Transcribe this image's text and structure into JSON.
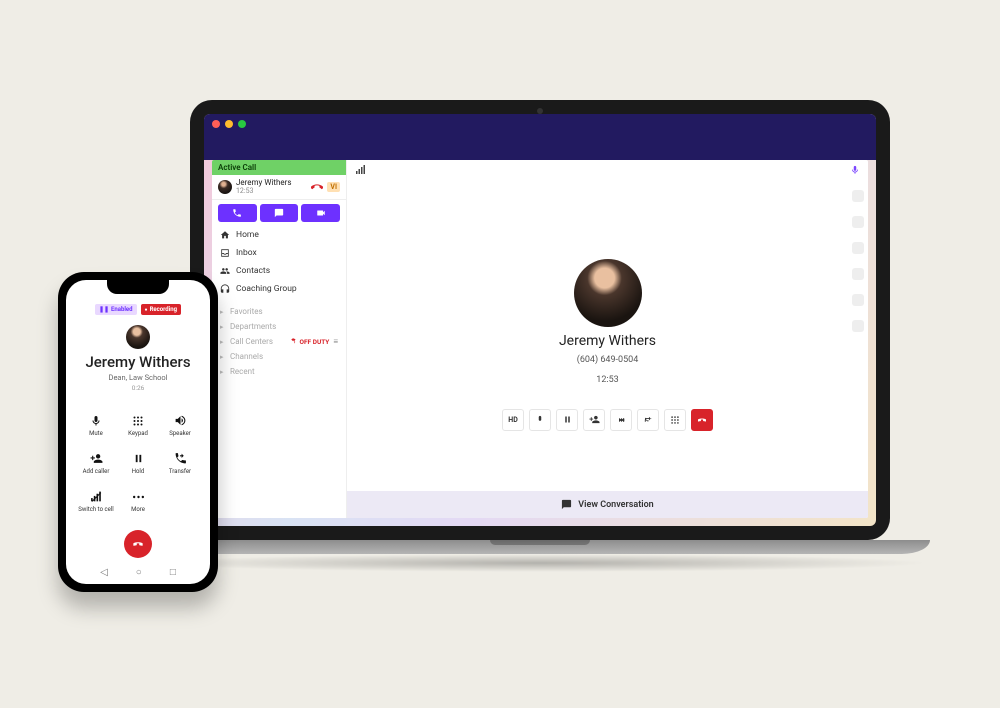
{
  "colors": {
    "accent": "#6d31ff",
    "danger": "#d8232a",
    "active_green": "#6fd166",
    "header_purple": "#221a60"
  },
  "laptop": {
    "active_call_label": "Active Call",
    "active_call_name": "Jeremy Withers",
    "active_call_time": "12:53",
    "active_call_badge": "VI",
    "triple_buttons": {
      "phone": "phone-icon",
      "chat": "chat-icon",
      "video": "video-icon"
    },
    "nav": {
      "home": "Home",
      "inbox": "Inbox",
      "contacts": "Contacts",
      "coaching": "Coaching Group"
    },
    "groups": {
      "favorites": "Favorites",
      "departments": "Departments",
      "call_centers": "Call Centers",
      "channels": "Channels",
      "recent": "Recent",
      "off_duty": "OFF DUTY"
    },
    "main": {
      "name": "Jeremy Withers",
      "phone_number": "(604) 649-0504",
      "duration": "12:53",
      "view_conversation": "View Conversation"
    },
    "call_buttons": {
      "hd": "HD",
      "mic": "mic-icon",
      "pause": "pause-icon",
      "add_person": "add-person-icon",
      "voicemail": "voicemail-icon",
      "transfer": "transfer-icon",
      "keypad": "keypad-icon",
      "end": "hangup-icon"
    }
  },
  "phone": {
    "badge_enabled": "Enabled",
    "badge_recording": "Recording",
    "name": "Jeremy Withers",
    "role": "Dean, Law School",
    "duration": "0:26",
    "controls": {
      "mute": "Mute",
      "keypad": "Keypad",
      "speaker": "Speaker",
      "add_caller": "Add caller",
      "hold": "Hold",
      "transfer": "Transfer",
      "switch": "Switch to cell",
      "more": "More"
    }
  }
}
